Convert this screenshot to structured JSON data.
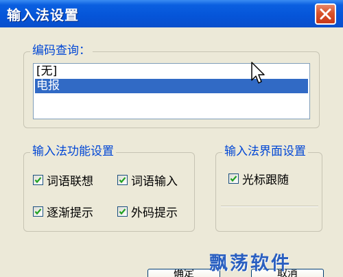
{
  "window": {
    "title": "输入法设置"
  },
  "query_group": {
    "label": "编码查询：",
    "items": [
      {
        "label": "[无]",
        "selected": false
      },
      {
        "label": "电报",
        "selected": true
      }
    ]
  },
  "function_group": {
    "label": "输入法功能设置",
    "options": [
      {
        "label": "词语联想",
        "checked": true
      },
      {
        "label": "词语输入",
        "checked": true
      },
      {
        "label": "逐渐提示",
        "checked": true
      },
      {
        "label": "外码提示",
        "checked": true
      }
    ]
  },
  "interface_group": {
    "label": "输入法界面设置",
    "options": [
      {
        "label": "光标跟随",
        "checked": true
      }
    ]
  },
  "buttons": {
    "ok_label": "确定",
    "cancel_label": "取消"
  },
  "watermark": {
    "text": "飘荡软件"
  },
  "colors": {
    "titlebar": "#0554d8",
    "group_label": "#0046d5",
    "selection": "#316ac5",
    "close_button": "#d9532b"
  }
}
